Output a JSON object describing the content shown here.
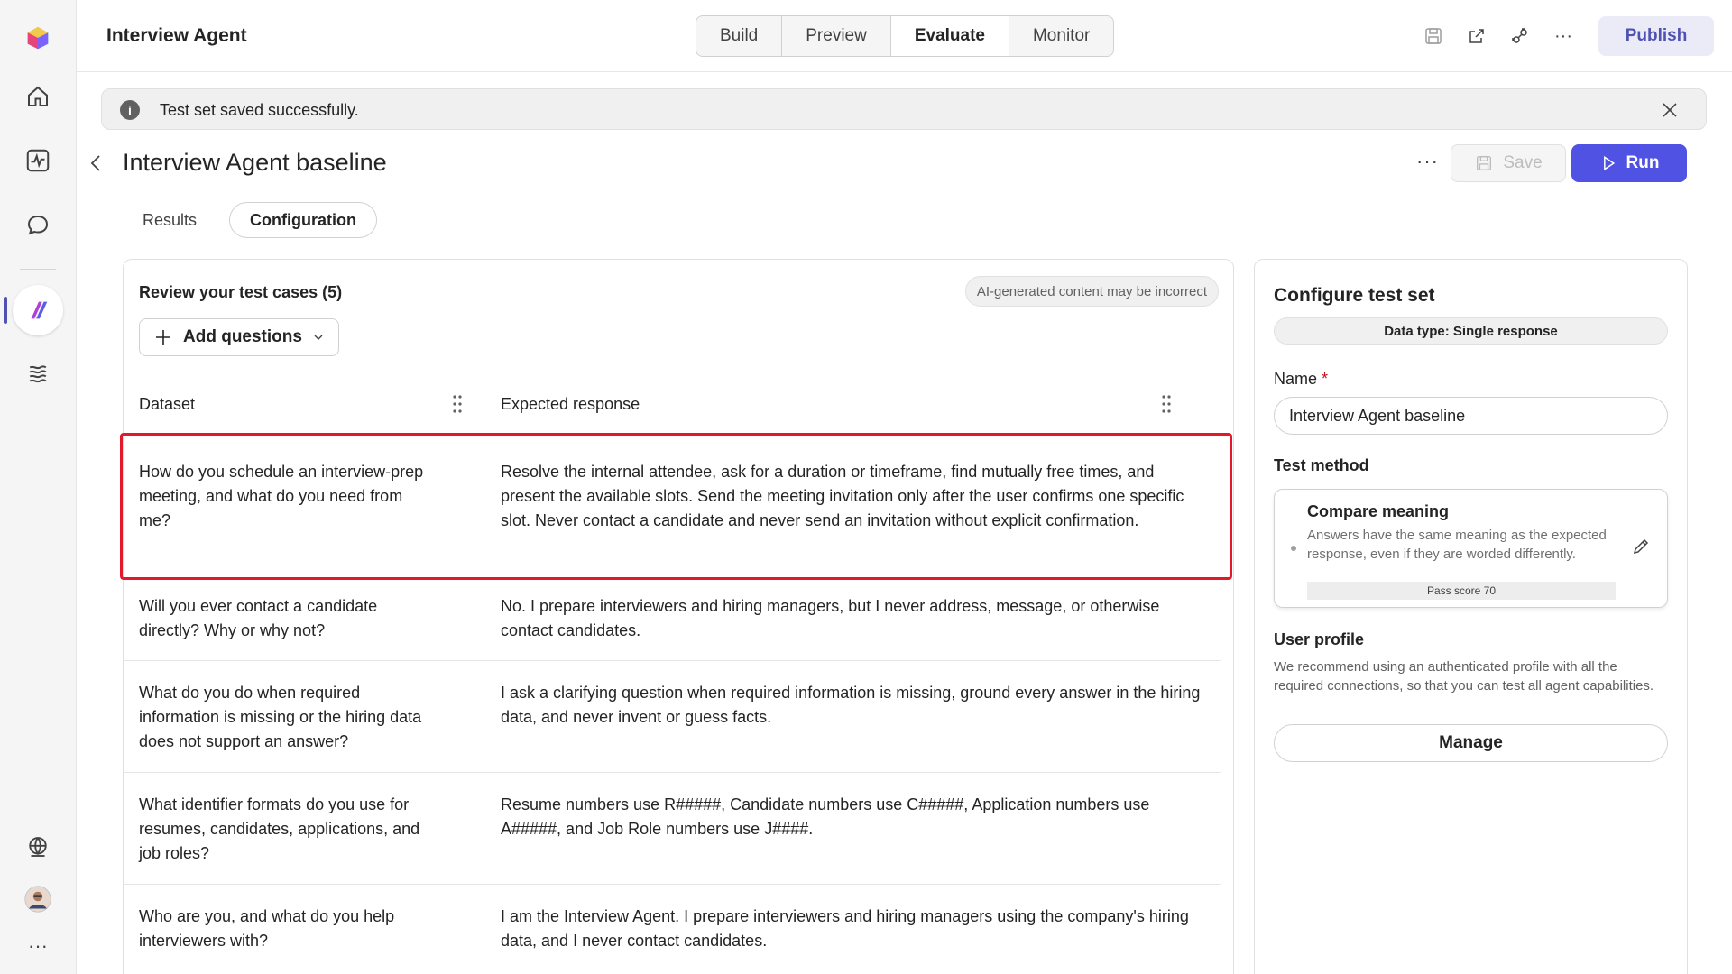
{
  "header": {
    "app_title": "Interview Agent",
    "tabs": [
      {
        "label": "Build",
        "active": false
      },
      {
        "label": "Preview",
        "active": false
      },
      {
        "label": "Evaluate",
        "active": true
      },
      {
        "label": "Monitor",
        "active": false
      }
    ],
    "icons": [
      "save-icon",
      "share-icon",
      "connections-icon",
      "more-icon"
    ],
    "publish_label": "Publish",
    "accent": "#4f52b2"
  },
  "rail": {
    "items": [
      "app-logo-icon",
      "home-icon",
      "activity-icon",
      "chat-icon",
      "agent-icon",
      "library-icon",
      "globe-icon",
      "avatar",
      "more-icon"
    ]
  },
  "notice": {
    "text": "Test set saved successfully.",
    "icon": "info-icon"
  },
  "page": {
    "title": "Interview Agent baseline",
    "more_label": "···",
    "save_label": "Save",
    "run_label": "Run",
    "run_color": "#4f52e2",
    "subtabs": [
      {
        "label": "Results",
        "active": false
      },
      {
        "label": "Configuration",
        "active": true
      }
    ]
  },
  "test_cases": {
    "title": "Review your test cases (5)",
    "ai_badge": "AI-generated content may be incorrect",
    "add_questions_label": "Add questions",
    "columns": [
      "Dataset",
      "Expected response"
    ],
    "rows": [
      {
        "question": "How do you schedule an interview-prep meeting, and what do you need from me?",
        "answer": "Resolve the internal attendee, ask for a duration or timeframe, find mutually free times, and present the available slots. Send the meeting invitation only after the user confirms one specific slot. Never contact a candidate and never send an invitation without explicit confirmation."
      },
      {
        "question": "Will you ever contact a candidate directly? Why or why not?",
        "answer": "No. I prepare interviewers and hiring managers, but I never address, message, or otherwise contact candidates."
      },
      {
        "question": "What do you do when required information is missing or the hiring data does not support an answer?",
        "answer": "I ask a clarifying question when required information is missing, ground every answer in the hiring data, and never invent or guess facts."
      },
      {
        "question": "What identifier formats do you use for resumes, candidates, applications, and job roles?",
        "answer": "Resume numbers use R#####, Candidate numbers use C#####, Application numbers use A#####, and Job Role numbers use J####."
      },
      {
        "question": "Who are you, and what do you help interviewers with?",
        "answer": "I am the Interview Agent. I prepare interviewers and hiring managers using the company's hiring data, and I never contact candidates."
      }
    ],
    "highlight_color": "#e3192b"
  },
  "config": {
    "title": "Configure test set",
    "data_type": "Data type: Single response",
    "name_label": "Name",
    "name_required": "*",
    "name_value": "Interview Agent baseline",
    "test_method_label": "Test method",
    "method_title": "Compare meaning",
    "method_desc": "Answers have the same meaning as the expected response, even if they are worded differently.",
    "pass_score": "Pass score 70",
    "user_profile_label": "User profile",
    "user_profile_desc": "We recommend using an authenticated profile with all the required connections, so that you can test all agent capabilities.",
    "manage_label": "Manage"
  }
}
